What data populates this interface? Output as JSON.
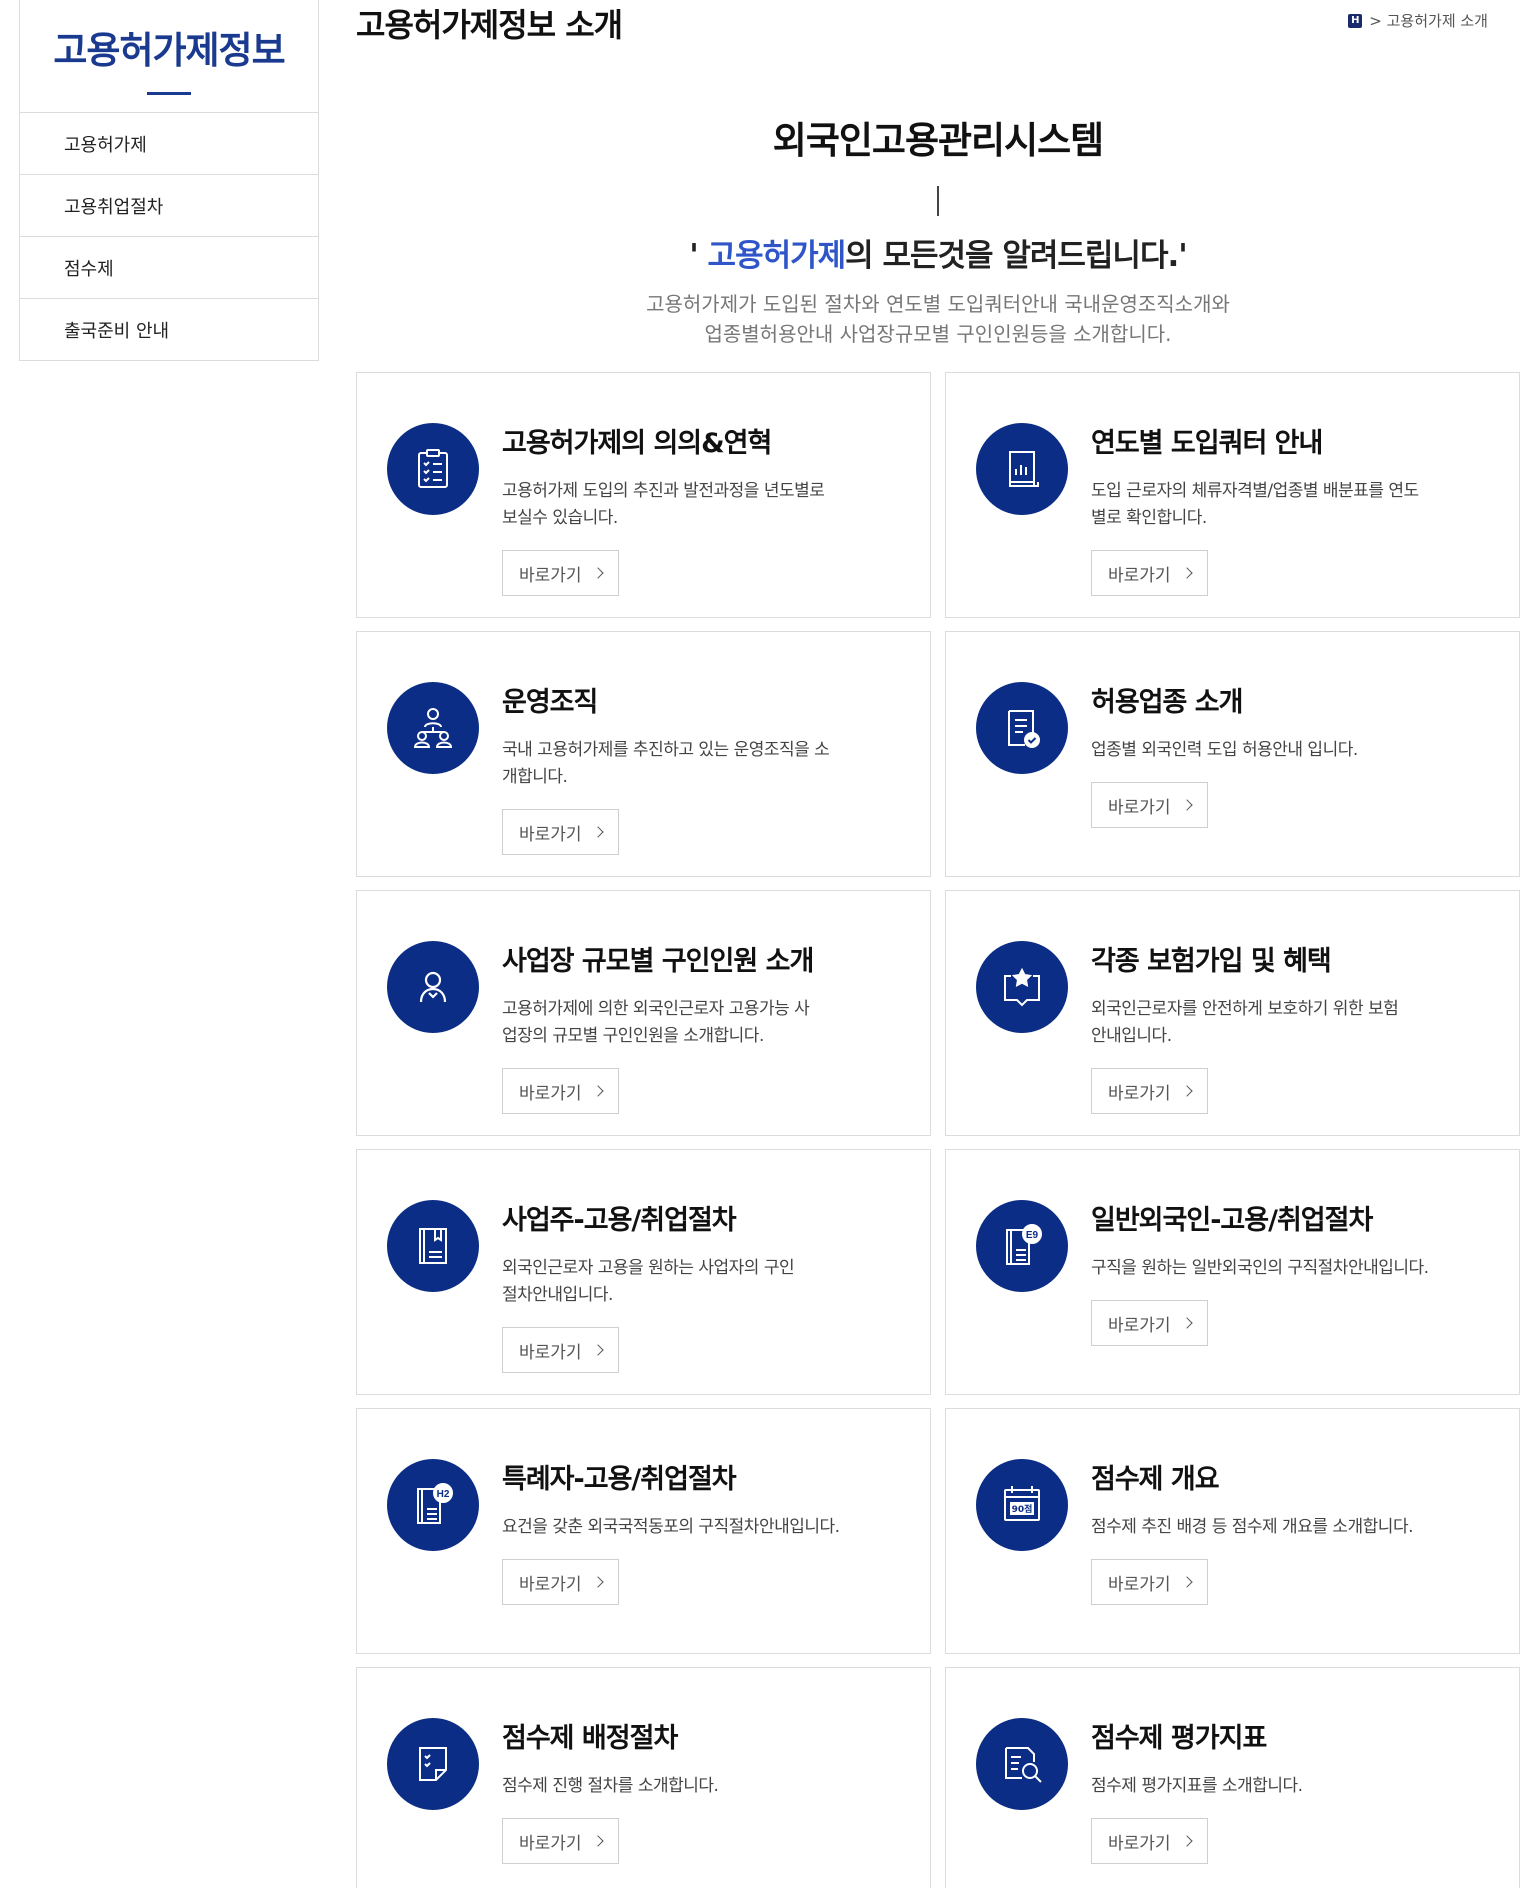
{
  "sidebar": {
    "title": "고용허가제정보",
    "items": [
      "고용허가제",
      "고용취업절차",
      "점수제",
      "출국준비 안내"
    ]
  },
  "header": {
    "page_title": "고용허가제정보 소개",
    "breadcrumb_home": "H",
    "breadcrumb": "> 고용허가제 소개"
  },
  "intro": {
    "title": "외국인고용관리시스템",
    "slogan_open": "' ",
    "slogan_highlight": "고용허가제",
    "slogan_rest": "의 모든것을 알려드립니다.'",
    "desc_line1": "고용허가제가 도입된 절차와 연도별 도입쿼터안내 국내운영조직소개와",
    "desc_line2": "업종별허용안내 사업장규모별 구인인원등을 소개합니다."
  },
  "button_label": "바로가기",
  "cards": [
    {
      "title": "고용허가제의 의의&연혁",
      "desc": "고용허가제 도입의 추진과 발전과정을 년도별로 보실수 있습니다.",
      "icon": "checklist-icon"
    },
    {
      "title": "연도별 도입쿼터 안내",
      "desc": "도입 근로자의 체류자격별/업종별 배분표를 연도별로 확인합니다.",
      "icon": "bar-chart-document-icon"
    },
    {
      "title": "운영조직",
      "desc": "국내 고용허가제를 추진하고 있는 운영조직을 소개합니다.",
      "icon": "organization-icon"
    },
    {
      "title": "허용업종 소개",
      "desc": "업종별 외국인력 도입 허용안내 입니다.",
      "icon": "approved-document-icon"
    },
    {
      "title": "사업장 규모별 구인인원 소개",
      "desc": "고용허가제에 의한 외국인근로자 고용가능 사업장의 규모별 구인인원을 소개합니다.",
      "icon": "person-icon"
    },
    {
      "title": "각종 보험가입 및 혜택",
      "desc": "외국인근로자를 안전하게 보호하기 위한 보험안내입니다.",
      "icon": "star-message-icon"
    },
    {
      "title": "사업주-고용/취업절차",
      "desc": "외국인근로자 고용을 원하는 사업자의 구인절차안내입니다.",
      "icon": "bookmark-book-icon"
    },
    {
      "title": "일반외국인-고용/취업절차",
      "desc": "구직을 원하는 일반외국인의 구직절차안내입니다.",
      "icon": "e9-book-icon",
      "badge": "E9"
    },
    {
      "title": "특례자-고용/취업절차",
      "desc": "요건을 갖춘 외국국적동포의 구직절차안내입니다.",
      "icon": "h2-book-icon",
      "badge": "H2"
    },
    {
      "title": "점수제 개요",
      "desc": "점수제 추진 배경 등 점수제 개요를 소개합니다.",
      "icon": "score-calendar-icon",
      "badge": "90점"
    },
    {
      "title": "점수제 배정절차",
      "desc": "점수제 진행 절차를 소개합니다.",
      "icon": "checklist-note-icon"
    },
    {
      "title": "점수제 평가지표",
      "desc": "점수제 평가지표를 소개합니다.",
      "icon": "magnifier-document-icon"
    }
  ]
}
